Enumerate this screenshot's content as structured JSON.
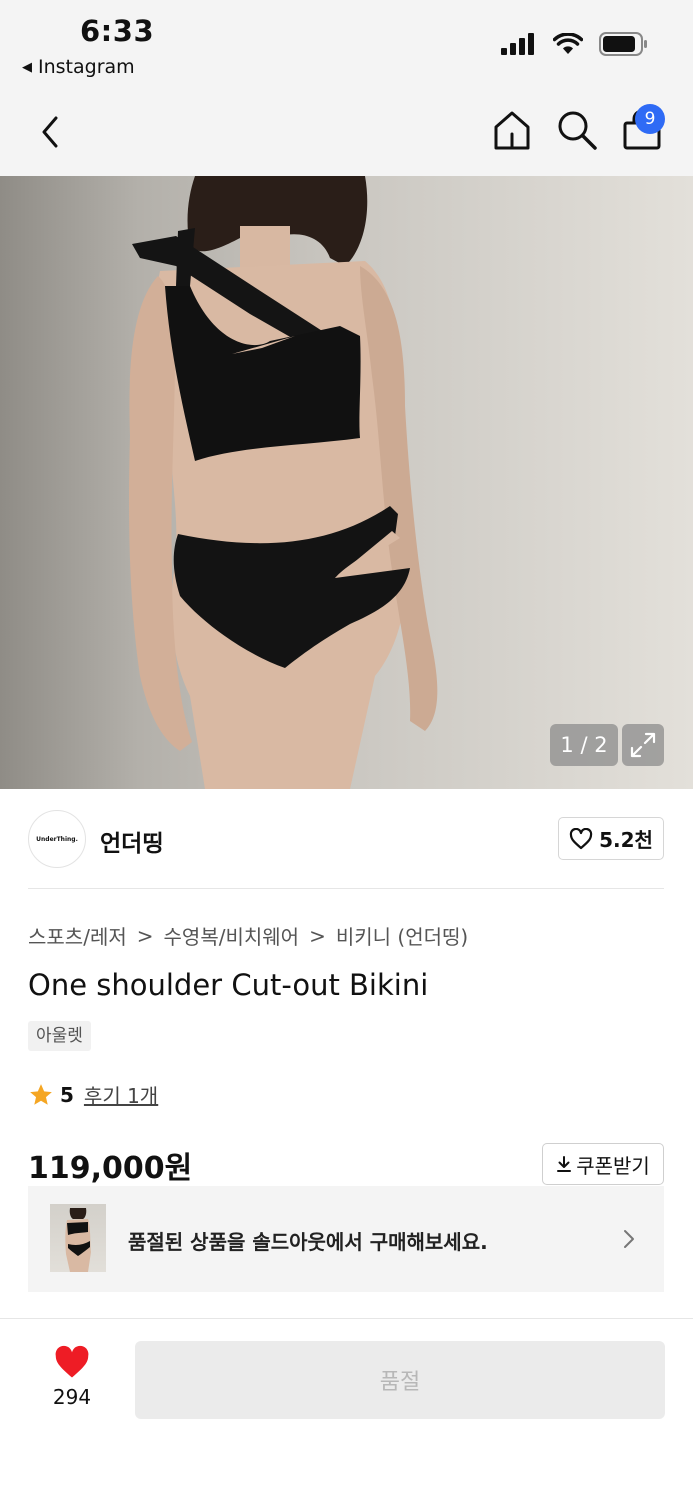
{
  "status_bar": {
    "time": "6:33",
    "back_app": "Instagram",
    "icons": [
      "cellular-signal-icon",
      "wifi-icon",
      "battery-icon"
    ]
  },
  "nav": {
    "icons": [
      "back-arrow-icon",
      "home-icon",
      "search-icon",
      "cart-icon"
    ],
    "cart_badge": "9",
    "badge_color": "#2f6bf5"
  },
  "hero": {
    "counter": "1 / 2",
    "expand_icon": "expand-icon"
  },
  "brand": {
    "logo_text": "UnderThing.",
    "name": "언더띵",
    "like_count": "5.2천"
  },
  "breadcrumb": [
    "스포츠/레저",
    "수영복/비치웨어",
    "비키니 (언더띵)"
  ],
  "product": {
    "title": "One shoulder Cut-out Bikini",
    "tag": "아울렛",
    "rating_score": "5",
    "reviews": "후기 1개",
    "price": "119,000원",
    "coupon_label": "쿠폰받기"
  },
  "soldout_banner": {
    "text": "품절된 상품을 솔드아웃에서 구매해보세요."
  },
  "bottom_bar": {
    "wish_count": "294",
    "buy_label": "품절",
    "heart_color": "#ee1c25"
  }
}
